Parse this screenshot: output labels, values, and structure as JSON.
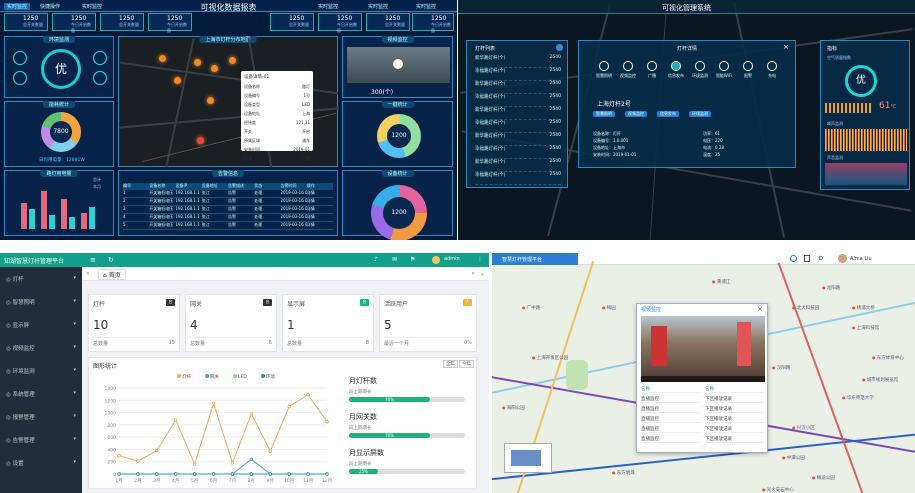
{
  "q1": {
    "title": "可视化数据报表",
    "tabs": [
      "实时监控",
      "快捷操作",
      "实时监控",
      "实时监控",
      "实时监控",
      "实时监控",
      "实时监控"
    ],
    "cards": [
      {
        "value": "1250",
        "label": "总开关数量"
      },
      {
        "value": "1250",
        "label": "今日开启数量"
      },
      {
        "value": "1250",
        "label": "总开关数量"
      },
      {
        "value": "1250",
        "label": "今日开启数量"
      },
      {
        "value": "1250",
        "label": "总开关数量"
      },
      {
        "value": "1250",
        "label": "今日开启数量"
      },
      {
        "value": "1250",
        "label": "总开关数量"
      },
      {
        "value": "1250",
        "label": "今日开启数量"
      }
    ],
    "panels": {
      "env": "环境监测",
      "stats": "能耗统计",
      "map": "上海市灯杆分布地图",
      "video": "视频监控",
      "pie": "一键统计",
      "bar": "路灯用电量",
      "table": "告警信息",
      "ring": "设备统计"
    },
    "quality": "优",
    "donut_value": "7800",
    "video_count": "300(个)",
    "pie_value": "1200",
    "ring_value": "1200",
    "total_label": "日均用电量：12891W",
    "bar_legend": [
      "总计",
      "本月"
    ],
    "table_headers": [
      "编号",
      "设备名称",
      "设备IP",
      "设备地址",
      "告警描述",
      "状态",
      "告警时间",
      "操作"
    ],
    "table_rows": [
      [
        "1",
        "开关箱低电压",
        "192.168.1.1",
        "张江",
        "告警",
        "处理",
        "2019-03-16 08:00",
        "详情"
      ],
      [
        "2",
        "开关箱低电压",
        "192.168.1.1",
        "张江",
        "告警",
        "处理",
        "2019-03-16 08:00",
        "详情"
      ],
      [
        "3",
        "开关箱低电压",
        "192.168.1.1",
        "张江",
        "告警",
        "处理",
        "2019-03-16 08:00",
        "详情"
      ],
      [
        "4",
        "开关箱低电压",
        "192.168.1.1",
        "张江",
        "告警",
        "处理",
        "2019-03-16 08:00",
        "详情"
      ],
      [
        "5",
        "开关箱低电压",
        "192.168.1.1",
        "张江",
        "告警",
        "处理",
        "2019-03-16 08:00",
        "详情"
      ]
    ],
    "popup_title": "设备详情-01",
    "popup_lines": [
      "设备名称",
      "设备编号",
      "设备类型",
      "设备地址",
      "经纬度",
      "开关",
      "所属区域",
      "安装时间",
      "厂家"
    ],
    "popup_values": [
      "路灯",
      "1号",
      "LED",
      "上海",
      "121,31",
      "开启",
      "浦东",
      "2019-01",
      "厂家"
    ]
  },
  "q2": {
    "title": "可视化管理系统",
    "left_title": "灯杆列表",
    "left_items": [
      {
        "name": "新华路灯杆(个)",
        "val": "2540"
      },
      {
        "name": "幸福路灯杆(个)",
        "val": "2540"
      },
      {
        "name": "新华路灯杆(个)",
        "val": "2540"
      },
      {
        "name": "幸福路灯杆(个)",
        "val": "2540"
      },
      {
        "name": "新华路灯杆(个)",
        "val": "2540"
      },
      {
        "name": "幸福路灯杆(个)",
        "val": "2540"
      },
      {
        "name": "新华路灯杆(个)",
        "val": "2540"
      },
      {
        "name": "幸福路灯杆(个)",
        "val": "2540"
      },
      {
        "name": "新华路灯杆(个)",
        "val": "2540"
      },
      {
        "name": "幸福路灯杆(个)",
        "val": "2540"
      }
    ],
    "modal_title": "灯杆详情",
    "modal_icons": [
      "智慧照明",
      "视频监控",
      "广播",
      "信息发布",
      "环境监测",
      "智能WiFi",
      "报警",
      "充电"
    ],
    "lamp_name": "上海灯杆2号",
    "chips": [
      "智慧照明",
      "视频监控",
      "信息发布",
      "环境监测"
    ],
    "info_left": [
      "设备名称：灯杆",
      "设备编号：1.0.001",
      "设备地址：上海市",
      "安装时间：2019-01-01"
    ],
    "info_right": [
      "功率：61",
      "电压：220",
      "电流：0.28",
      "温度：25"
    ],
    "right_title": "指标",
    "right_sub": "空气质量指数",
    "quality": "优",
    "temp": "61",
    "temp_unit": "℃",
    "noise_label": "噪声监测",
    "wave_label": "声音监测"
  },
  "q3": {
    "brand": "知湖智慧灯杆管理平台",
    "user": "admin",
    "menu": [
      "灯杆",
      "智慧照明",
      "显示屏",
      "视频监控",
      "环境监测",
      "系统管理",
      "报警管理",
      "告警管理",
      "设置"
    ],
    "tab": "首页",
    "cards": [
      {
        "label": "灯杆",
        "value": "10",
        "foot": "总数量",
        "foot_val": "15",
        "badge": "台"
      },
      {
        "label": "网关",
        "value": "4",
        "foot": "总数量",
        "foot_val": "6",
        "badge": "台"
      },
      {
        "label": "显示屏",
        "value": "1",
        "foot": "总数量",
        "foot_val": "8",
        "badge": "台"
      },
      {
        "label": "活跃用户",
        "value": "5",
        "foot": "最近一个月",
        "foot_val": "0%",
        "badge": "人"
      }
    ],
    "chart_title": "图形统计",
    "chart_buttons": [
      "全年",
      "今年"
    ],
    "right_blocks": [
      {
        "title": "月灯杆数",
        "sub": "同上期增长",
        "pct": "70%"
      },
      {
        "title": "月网关数",
        "sub": "同上期增长",
        "pct": "70%"
      },
      {
        "title": "月显示屏数",
        "sub": "同上期增长",
        "pct": "25%"
      }
    ]
  },
  "q4": {
    "brand": "智慧灯杆管理平台",
    "user": "Alma Liu",
    "popup_title": "视频监控",
    "menu_left": [
      "名称",
      "直播监控",
      "直播监控",
      "直播监控",
      "直播监控",
      "直播监控"
    ],
    "menu_right": [
      "名称",
      "下区播放记录",
      "下区播放记录",
      "下区播放记录",
      "下区播放记录",
      "下区播放记录"
    ],
    "places": [
      "上海开发区公园",
      "北大科技园",
      "龙阳路",
      "上海科技馆",
      "东方体育中心",
      "华东师范大学",
      "兴汉小区",
      "海阳公园",
      "梅园",
      "广中路",
      "黄浦江",
      "汉阳路",
      "城市规划展览馆",
      "杨浦大桥",
      "中潭公园",
      "光大安石中心",
      "东方明珠",
      "梅迪公园"
    ]
  },
  "chart_data": {
    "type": "line",
    "title": "",
    "categories": [
      "1月",
      "2月",
      "3月",
      "4月",
      "5月",
      "6月",
      "7月",
      "8月",
      "9月",
      "10月",
      "11月",
      "12月"
    ],
    "ylim": [
      0,
      1400
    ],
    "series": [
      {
        "name": "灯杆",
        "color": "#f3a85c",
        "values": [
          300,
          210,
          380,
          880,
          160,
          1150,
          180,
          980,
          370,
          1100,
          1290,
          850
        ]
      },
      {
        "name": "网关",
        "color": "#4fa6d8",
        "values": [
          0,
          0,
          0,
          0,
          0,
          0,
          0,
          240,
          0,
          0,
          0,
          0
        ]
      },
      {
        "name": "LED",
        "color": "#8fd3a6",
        "values": [
          0,
          0,
          0,
          0,
          0,
          0,
          0,
          0,
          0,
          0,
          0,
          0
        ]
      },
      {
        "name": "环境",
        "color": "#2c8fb8",
        "values": [
          0,
          0,
          0,
          0,
          0,
          0,
          0,
          0,
          0,
          0,
          0,
          0
        ]
      }
    ]
  }
}
